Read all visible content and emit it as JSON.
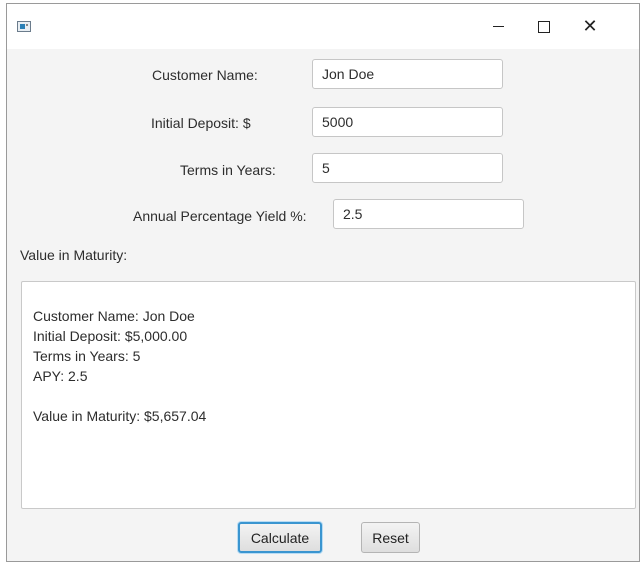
{
  "window": {
    "minimize_glyph": "—",
    "close_glyph": "✕"
  },
  "form": {
    "customer_name_label": "Customer Name:",
    "customer_name_value": "Jon Doe",
    "initial_deposit_label": "Initial Deposit: $",
    "initial_deposit_value": "5000",
    "terms_label": "Terms in Years:",
    "terms_value": "5",
    "apy_label": "Annual Percentage Yield %:",
    "apy_value": "2.5"
  },
  "output": {
    "label": "Value in Maturity:",
    "text": "Customer Name: Jon Doe\nInitial Deposit: $5,000.00\nTerms in Years: 5\nAPY: 2.5\n\nValue in Maturity: $5,657.04"
  },
  "buttons": {
    "calculate": "Calculate",
    "reset": "Reset"
  }
}
